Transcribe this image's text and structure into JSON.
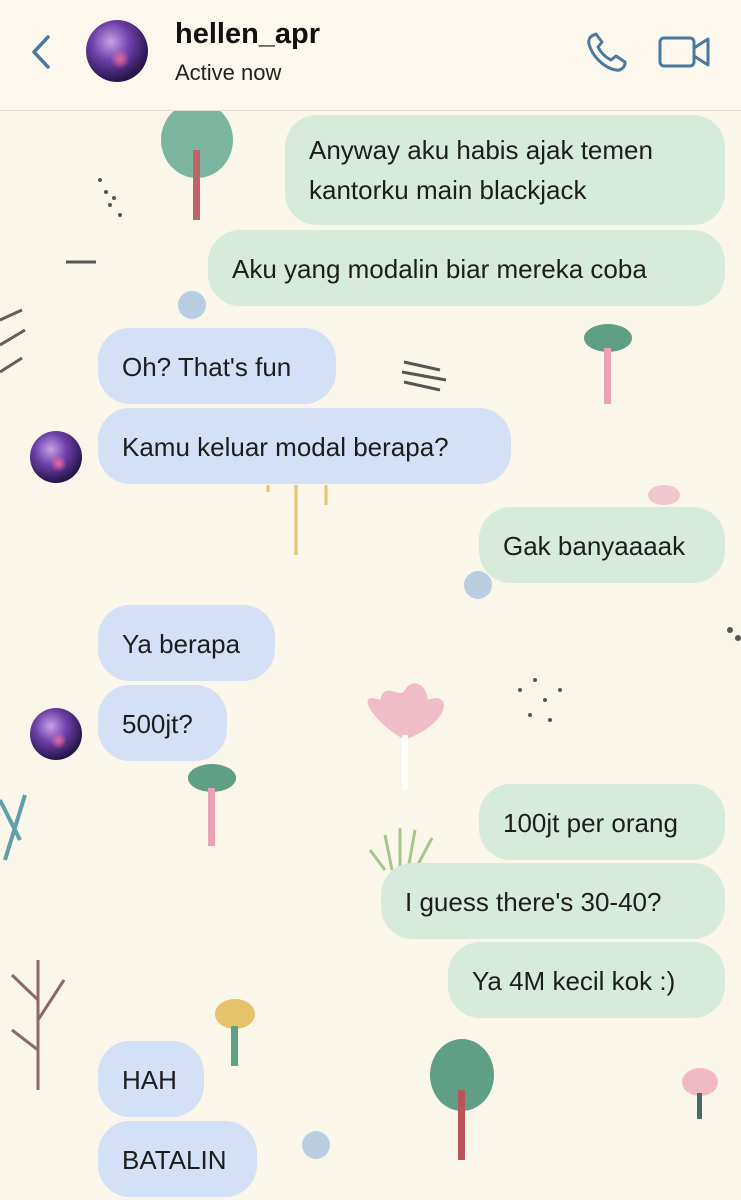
{
  "header": {
    "contact_name": "hellen_apr",
    "status": "Active now",
    "back_icon": "chevron-left-icon",
    "call_icon": "phone-icon",
    "video_icon": "video-camera-icon"
  },
  "messages": [
    {
      "side": "out",
      "text": "Anyway aku habis ajak temen\nkantorku main blackjack"
    },
    {
      "side": "out",
      "text": "Aku yang modalin biar mereka coba"
    },
    {
      "side": "in",
      "text": "Oh? That's fun"
    },
    {
      "side": "in",
      "text": "Kamu keluar modal berapa?"
    },
    {
      "side": "out",
      "text": "Gak banyaaaak"
    },
    {
      "side": "in",
      "text": "Ya berapa"
    },
    {
      "side": "in",
      "text": "500jt?"
    },
    {
      "side": "out",
      "text": "100jt per orang"
    },
    {
      "side": "out",
      "text": "I guess there's 30-40?"
    },
    {
      "side": "out",
      "text": "Ya 4M kecil kok :)"
    },
    {
      "side": "in",
      "text": "HAH"
    },
    {
      "side": "in",
      "text": "BATALIN"
    }
  ],
  "colors": {
    "background": "#fbf6ea",
    "outgoing_bubble": "#d6ebdc",
    "incoming_bubble": "#d3e0f6",
    "icon": "#4a7aa0"
  }
}
